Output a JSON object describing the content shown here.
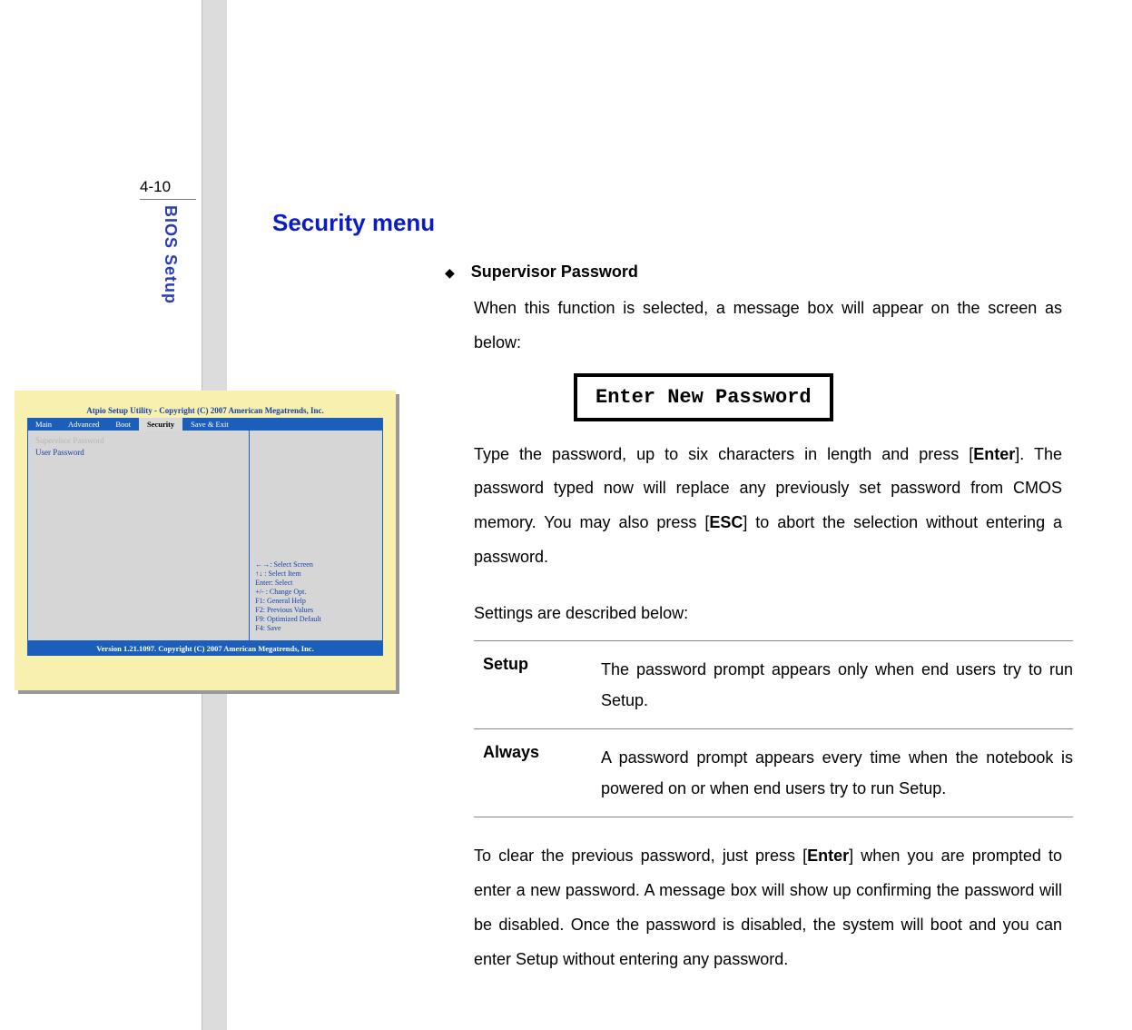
{
  "page_number": "4-10",
  "section_label": "BIOS Setup",
  "title": "Security menu",
  "bullet": {
    "symbol": "◆",
    "heading": "Supervisor Password"
  },
  "para1": "When this function is selected, a message box will appear on the screen as below:",
  "password_box": "Enter New Password",
  "para2_a": "Type the password, up to six characters in length and press [",
  "para2_key1": "Enter",
  "para2_b": "].   The password typed now will replace any previously set password from CMOS memory. You may also press [",
  "para2_key2": "ESC",
  "para2_c": "] to abort the selection  without  entering a password.",
  "settings_intro": "Settings are described below:",
  "settings": [
    {
      "label": "Setup",
      "desc": "The password prompt appears only when end users try to run Setup."
    },
    {
      "label": "Always",
      "desc": "A password prompt appears every time when the notebook is powered on or when end users try to run Setup."
    }
  ],
  "para3_a": "To clear the previous password, just press [",
  "para3_key": "Enter",
  "para3_b": "] when you are prompted to enter  a new password.   A message box will show up confirming the password will be disabled.  Once the password is disabled, the system will boot and you can enter Setup without entering any password.",
  "bios": {
    "title": "Atpio Setup Utility - Copyright (C) 2007 American Megatrends, Inc.",
    "tabs": [
      "Main",
      "Advanced",
      "Boot",
      "Security",
      "Save & Exit"
    ],
    "active_tab_index": 3,
    "left_items": {
      "supervisor": "Supervisor Password",
      "user": "User Password"
    },
    "help": [
      "←→: Select Screen",
      "↑↓ : Select Item",
      "Enter:  Select",
      "+/- : Change Opt.",
      "F1: General Help",
      "F2: Previous Values",
      "F9: Optimized Default",
      "F4: Save"
    ],
    "footer": "Version 1.21.1097. Copyright (C) 2007 American Megatrends, Inc."
  }
}
